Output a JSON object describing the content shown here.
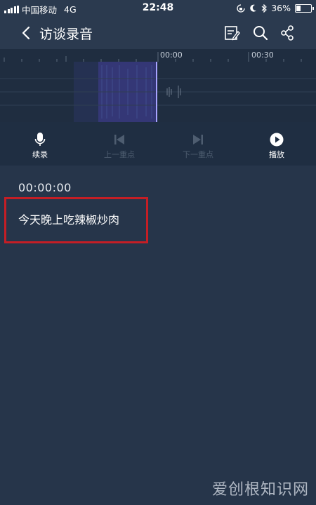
{
  "status_bar": {
    "carrier": "中国移动",
    "network": "4G",
    "time": "22:48",
    "battery": "36%",
    "battery_level": 0.36
  },
  "nav": {
    "title": "访谈录音",
    "icons": [
      "back-icon",
      "edit-note-icon",
      "search-icon",
      "share-icon"
    ]
  },
  "waveform": {
    "ticks": [
      "00:00",
      "00:30"
    ]
  },
  "controls": {
    "record": "续录",
    "prev_mark": "上一重点",
    "next_mark": "下一重点",
    "play": "播放"
  },
  "transcript": {
    "timestamp": "00:00:00",
    "text": "今天晚上吃辣椒炒肉"
  },
  "watermark": "爱创根知识网",
  "colors": {
    "background": "#26354a",
    "header": "#2b3a4f",
    "waveform_bg": "#1f2d40",
    "playhead": "#a7a3ff",
    "highlight_border": "#c41e25"
  }
}
